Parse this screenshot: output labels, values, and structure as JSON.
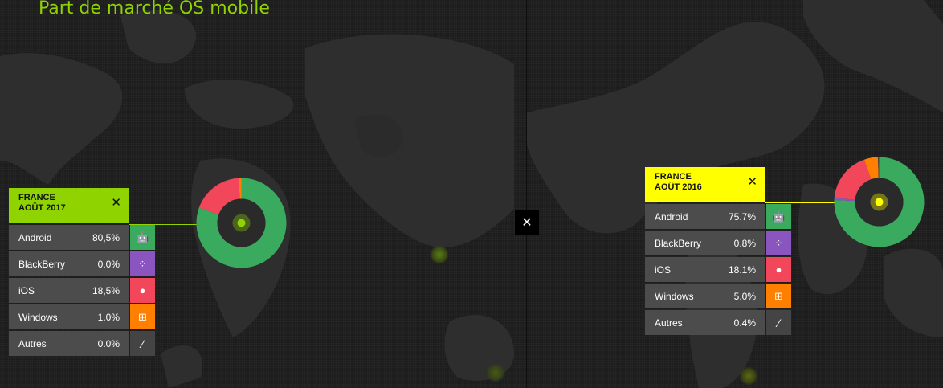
{
  "title": "Part de marché OS mobile",
  "colors": {
    "android": "#3aaa5e",
    "blackberry": "#8a55bf",
    "ios": "#f2475a",
    "windows": "#ff8000",
    "autres": "#444444",
    "left_head": "#8fd300",
    "right_head": "#ffff00"
  },
  "icons": {
    "android": "android-icon",
    "blackberry": "blackberry-icon",
    "ios": "apple-icon",
    "windows": "windows-icon",
    "autres": "slash-icon",
    "close": "close-icon"
  },
  "left": {
    "country": "FRANCE",
    "period": "AOÛT 2017",
    "rows": [
      {
        "name": "Android",
        "value": "80,5%"
      },
      {
        "name": "BlackBerry",
        "value": "0.0%"
      },
      {
        "name": "iOS",
        "value": "18,5%"
      },
      {
        "name": "Windows",
        "value": "1.0%"
      },
      {
        "name": "Autres",
        "value": "0.0%"
      }
    ]
  },
  "right": {
    "country": "FRANCE",
    "period": "AOÛT 2016",
    "rows": [
      {
        "name": "Android",
        "value": "75.7%"
      },
      {
        "name": "BlackBerry",
        "value": "0.8%"
      },
      {
        "name": "iOS",
        "value": "18.1%"
      },
      {
        "name": "Windows",
        "value": "5.0%"
      },
      {
        "name": "Autres",
        "value": "0.4%"
      }
    ]
  },
  "chart_data": [
    {
      "type": "pie",
      "categories": [
        "Android",
        "BlackBerry",
        "iOS",
        "Windows",
        "Autres"
      ],
      "values": [
        80.5,
        0.0,
        18.5,
        1.0,
        0.0
      ]
    },
    {
      "type": "pie",
      "categories": [
        "Android",
        "BlackBerry",
        "iOS",
        "Windows",
        "Autres"
      ],
      "values": [
        75.7,
        0.8,
        18.1,
        5.0,
        0.4
      ]
    }
  ]
}
